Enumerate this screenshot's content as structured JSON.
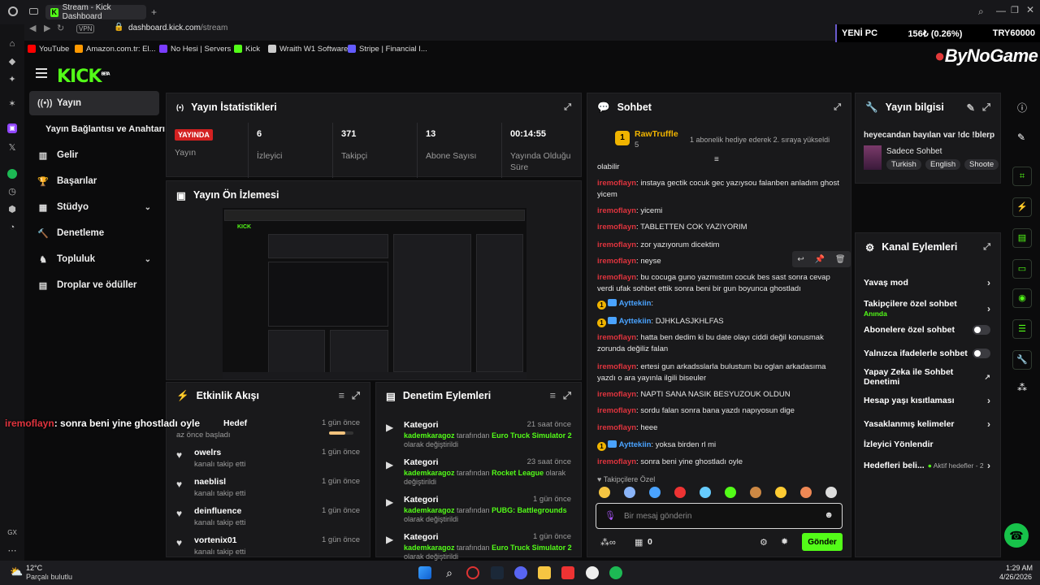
{
  "browser": {
    "tab_title": "Stream - Kick Dashboard",
    "url_host": "dashboard.kick.com",
    "url_path": "/stream",
    "vpn": "VPN",
    "bookmarks": [
      "YouTube",
      "Amazon.com.tr: El...",
      "No Hesi | Servers",
      "Kick",
      "Wraith W1 Software",
      "Stripe | Financial I..."
    ]
  },
  "overlay": {
    "ticker_name": "YENİ PC",
    "ticker_change": "156₺ (0.26%)",
    "ticker_price": "TRY60000",
    "brand": "ByNoGame",
    "chat_overlay_user": "iremoflayn",
    "chat_overlay_text": ": sonra beni yine ghostladı oyle"
  },
  "kick": {
    "logo": "KICK",
    "beta": "BETA",
    "nav": [
      "Yayın",
      "Yayın Bağlantısı ve Anahtarı",
      "Gelir",
      "Başarılar",
      "Stüdyo",
      "Denetleme",
      "Topluluk",
      "Droplar ve ödüller"
    ]
  },
  "stats": {
    "title": "Yayın İstatistikleri",
    "badge": "YAYINDA",
    "items": [
      {
        "value": "",
        "label": "Yayın"
      },
      {
        "value": "6",
        "label": "İzleyici"
      },
      {
        "value": "371",
        "label": "Takipçi"
      },
      {
        "value": "13",
        "label": "Abone Sayısı"
      },
      {
        "value": "00:14:55",
        "label": "Yayında Olduğu Süre"
      }
    ]
  },
  "preview": {
    "title": "Yayın Ön İzlemesi"
  },
  "activity": {
    "title": "Etkinlik Akışı",
    "items": [
      {
        "name": "Hedef",
        "sub": "az önce başladı",
        "time": "1 gün önce"
      },
      {
        "name": "owelrs",
        "sub": "kanalı takip etti",
        "time": "1 gün önce"
      },
      {
        "name": "naeblisl",
        "sub": "kanalı takip etti",
        "time": "1 gün önce"
      },
      {
        "name": "deinfluence",
        "sub": "kanalı takip etti",
        "time": "1 gün önce"
      },
      {
        "name": "vortenix01",
        "sub": "kanalı takip etti",
        "time": "1 gün önce"
      }
    ]
  },
  "moderation": {
    "title": "Denetim Eylemleri",
    "items": [
      {
        "name": "Kategori",
        "user": "kademkaragoz",
        "mid": " tarafından ",
        "game": "Euro Truck Simulator 2",
        "end": " olarak değiştirildi",
        "time": "21 saat önce"
      },
      {
        "name": "Kategori",
        "user": "kademkaragoz",
        "mid": " tarafından ",
        "game": "Rocket League",
        "end": " olarak değiştirildi",
        "time": "23 saat önce"
      },
      {
        "name": "Kategori",
        "user": "kademkaragoz",
        "mid": " tarafından ",
        "game": "PUBG: Battlegrounds",
        "end": " olarak değiştirildi",
        "time": "1 gün önce"
      },
      {
        "name": "Kategori",
        "user": "kademkaragoz",
        "mid": " tarafından ",
        "game": "Euro Truck Simulator 2",
        "end": " olarak değiştirildi",
        "time": "1 gün önce"
      }
    ]
  },
  "chat": {
    "title": "Sohbet",
    "pinned_user": "RawTruffle",
    "pinned_count": "5",
    "pinned_text": "1 abonelik hediye ederek 2. sıraya yükseldi",
    "messages": [
      {
        "u": "",
        "t": "olabilir"
      },
      {
        "u": "iremoflayn",
        "t": ": instaya gectik cocuk gec yazıysou falanben anladım ghost yicem"
      },
      {
        "u": "iremoflayn",
        "t": ": yicemi"
      },
      {
        "u": "iremoflayn",
        "t": ": TABLETTEN COK YAZIYORIM"
      },
      {
        "u": "iremoflayn",
        "t": ": zor yazıyorum dicektim"
      },
      {
        "u": "iremoflayn",
        "t": ": neyse"
      },
      {
        "u": "iremoflayn",
        "t": ": bu cocuga guno yazmıstım cocuk bes sast sonra cevap verdi ufak sohbet ettik sonra beni bir gun boyunca ghostladı"
      },
      {
        "u": "Ayttekiin",
        "t": ":"
      },
      {
        "u": "Ayttekiin",
        "t": ": DJHKLASJKHLFAS"
      },
      {
        "u": "iremoflayn",
        "t": ": hatta ben dedim ki bu date olayı ciddi değil konusmak zorunda değiliz falan"
      },
      {
        "u": "iremoflayn",
        "t": ": ertesi gun arkadsslarla bulustum bu oglan arkadasıma yazdı o ara yayınla ilgili biseuler"
      },
      {
        "u": "iremoflayn",
        "t": ": NAPTI SANA NASIK BESYUZOUK OLDUN"
      },
      {
        "u": "iremoflayn",
        "t": ": sordu falan sonra bana yazdı napıyosun dige"
      },
      {
        "u": "iremoflayn",
        "t": ": heee"
      },
      {
        "u": "Ayttekiin",
        "t": ": yoksa birden rl mi"
      },
      {
        "u": "iremoflayn",
        "t": ": sonra beni yine ghostladı oyle"
      }
    ],
    "followers_only": "Takipçilere Özel",
    "placeholder": "Bir mesaj gönderin",
    "points": "0",
    "send": "Gönder"
  },
  "stream_info": {
    "title": "Yayın bilgisi",
    "stream_title": "heyecandan bayılan var !dc !blerp",
    "category": "Sadece Sohbet",
    "tags": [
      "Turkish",
      "English",
      "Shoote"
    ]
  },
  "channel_actions": {
    "title": "Kanal Eylemleri",
    "items": [
      {
        "label": "Yavaş mod",
        "kind": "chev"
      },
      {
        "label": "Takipçilere özel sohbet",
        "sub": "Anında",
        "kind": "chev"
      },
      {
        "label": "Abonelere özel sohbet",
        "kind": "toggle"
      },
      {
        "label": "Yalnızca ifadelerle sohbet",
        "kind": "toggle"
      },
      {
        "label": "Yapay Zeka ile Sohbet Denetimi",
        "kind": "ext"
      },
      {
        "label": "Hesap yaşı kısıtlaması",
        "kind": "chev"
      },
      {
        "label": "Yasaklanmış kelimeler",
        "kind": "chev"
      },
      {
        "label": "İzleyici Yönlendir",
        "kind": "none"
      },
      {
        "label": "Hedefleri beli...",
        "sub": "Aktif hedefler - 2",
        "kind": "chev"
      }
    ]
  },
  "taskbar": {
    "temp": "12°C",
    "weather": "Parçalı bulutlu",
    "time": "1:29 AM",
    "date": "4/26/2026"
  },
  "colors": {
    "kick_green": "#53fc18",
    "live_red": "#d32121",
    "user_red": "#e0343e",
    "user_blue": "#4aa3ff"
  }
}
